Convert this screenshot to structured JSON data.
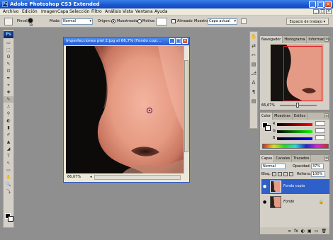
{
  "app": {
    "title": "Adobe Photoshop CS3 Extended",
    "icon_text": "Ps",
    "window_buttons": [
      "_",
      "□",
      "×"
    ],
    "doc_window_buttons": [
      "_",
      "□",
      "×"
    ]
  },
  "menu": [
    "Archivo",
    "Edición",
    "Imagen",
    "Capa",
    "Selección",
    "Filtro",
    "Análisis",
    "Vista",
    "Ventana",
    "Ayuda"
  ],
  "options": {
    "brush_label": "Pincel:",
    "brush_size": "19",
    "mode_label": "Modo:",
    "mode_value": "Normal",
    "origin_label": "Origen:",
    "sampled_label": "Muestreado",
    "pattern_label": "Motivo:",
    "aligned_label": "Alineado",
    "sample_label": "Muestra:",
    "sample_value": "Capa actual",
    "workspace_label": "Espacio de trabajo ▾"
  },
  "toolbox": {
    "logo": "Ps",
    "tools": [
      "▭",
      "⬚",
      "ʘ",
      "✎",
      "⊡",
      "✒",
      "⌖",
      "✚",
      "✎",
      "⎍",
      "⚲",
      "◐",
      "▮",
      "✐",
      "▲",
      "◢",
      "T",
      "↖",
      "▭",
      "✋",
      "🔍",
      "⤵"
    ]
  },
  "document": {
    "title": "Imperfecciones piel 2.jpg al 66,7% (Fondo copi...",
    "zoom": "66,67%",
    "scroll_label": "◂"
  },
  "icon_strip": [
    "✋",
    "⇄",
    "✂",
    "▤",
    "⎇",
    "Ａ",
    "¶",
    "▤"
  ],
  "navigator": {
    "tabs": [
      "Navegador",
      "Histograma",
      "Información"
    ],
    "zoom": "66,67%"
  },
  "color": {
    "tabs": [
      "Color",
      "Muestras",
      "Estilos"
    ],
    "channels": [
      "R",
      "G",
      "B"
    ],
    "colors": {
      "fg": "#000000",
      "bg": "#ffffff"
    }
  },
  "layers": {
    "tabs": [
      "Capas",
      "Canales",
      "Trazados"
    ],
    "blend_mode": "Normal",
    "opacity_label": "Opacidad:",
    "opacity_value": "37%",
    "lock_label": "Bloq.:",
    "fill_label": "Relleno:",
    "fill_value": "100%",
    "items": [
      {
        "name": "Fondo copia",
        "selected": true
      },
      {
        "name": "Fondo",
        "selected": false
      }
    ],
    "bottom_icons": [
      "∞",
      "fx",
      "◐",
      "▣",
      "▭",
      "🗑"
    ]
  },
  "colors": {
    "selection": "#2f5fc8",
    "titlebar": "#1a56d0",
    "workspace_bg": "#8f8f8f"
  }
}
